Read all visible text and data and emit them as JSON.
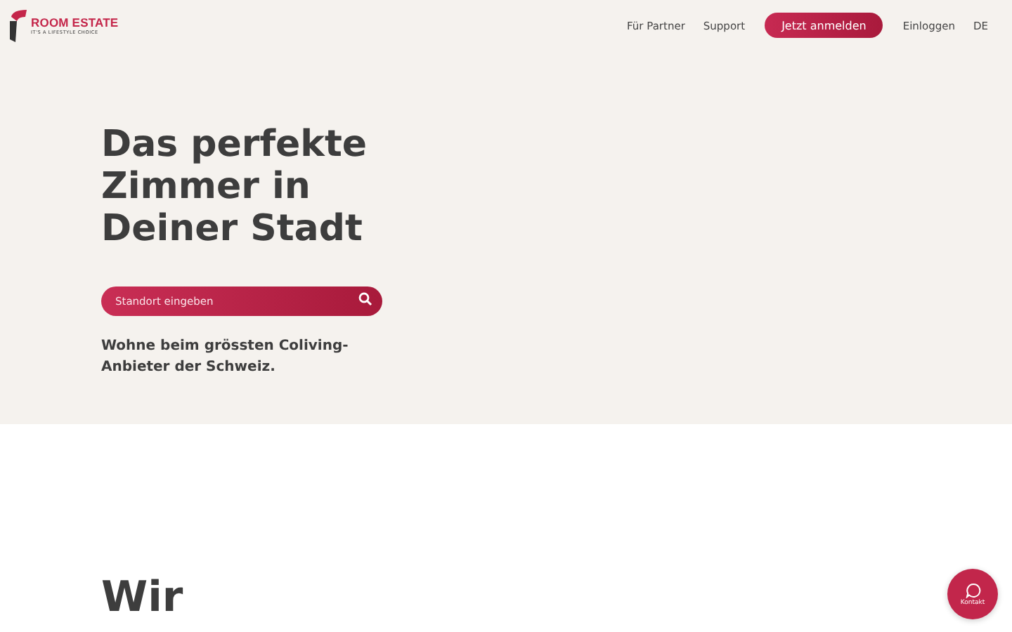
{
  "logo": {
    "name": "ROOM ESTATE",
    "tagline": "IT'S A LIFESTYLE CHOICE"
  },
  "nav": [
    {
      "label": "Für Partner",
      "kind": "link"
    },
    {
      "label": "Support",
      "kind": "link"
    },
    {
      "label": "Jetzt anmelden",
      "kind": "button"
    },
    {
      "label": "Einloggen",
      "kind": "link"
    },
    {
      "label": "DE",
      "kind": "link"
    }
  ],
  "hero": {
    "title": [
      "Das perfekte",
      "Zimmer in",
      "Deiner Stadt"
    ],
    "search": {
      "placeholder": "Standort eingeben"
    },
    "subtitle": [
      "Wohne beim grössten Coliving-",
      "Anbieter der Schweiz."
    ]
  },
  "section": {
    "heading": "Wir"
  },
  "contact_button": {
    "label": "Kontakt"
  }
}
